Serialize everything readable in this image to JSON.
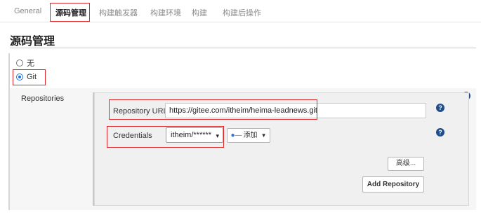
{
  "tabs": [
    {
      "label": "General",
      "active": false
    },
    {
      "label": "源码管理",
      "active": true
    },
    {
      "label": "构建触发器",
      "active": false
    },
    {
      "label": "构建环境",
      "active": false
    },
    {
      "label": "构建",
      "active": false
    },
    {
      "label": "构建后操作",
      "active": false
    }
  ],
  "section_title": "源码管理",
  "scm_options": [
    {
      "label": "无",
      "selected": false
    },
    {
      "label": "Git",
      "selected": true
    }
  ],
  "repositories": {
    "label": "Repositories",
    "url_label": "Repository URL",
    "url_value": "https://gitee.com/itheim/heima-leadnews.git",
    "credentials_label": "Credentials",
    "credentials_value": "itheim/******",
    "add_label": "添加",
    "advanced_label": "高级...",
    "add_repository_label": "Add Repository"
  },
  "help_glyph": "?",
  "colors": {
    "highlight_border": "#e1262a",
    "help_icon": "#1f4e8c",
    "radio_selected": "#1a73e8"
  }
}
